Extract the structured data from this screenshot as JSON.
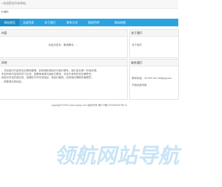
{
  "topbar": {
    "welcome": "• 欢迎您访问本网站。"
  },
  "logo": {
    "text": "Logo"
  },
  "nav": {
    "items": [
      {
        "label": "网站首页",
        "active": true
      },
      {
        "label": "全部列表"
      },
      {
        "label": "关于我们"
      },
      {
        "label": "联系方式"
      },
      {
        "label": "版权声明"
      },
      {
        "label": "网站地图"
      }
    ]
  },
  "main_panel": {
    "title": "内容",
    "body": "欢迎浏览本，敬请期待……"
  },
  "about_panel": {
    "title": "关于我们",
    "body": "关于我们"
  },
  "notice_panel": {
    "title": "声明",
    "body_lines": [
      "，本站部分内容来自互联网整理，如有侵权请及时与我们联系，我们会在第一时间处理。",
      "本站所有内容仅供学习交流，如需商用请与版权方联系，本站不承担任何法律责任。",
      "网站对内容的真实性、准确性不作任何保证，请自行甄别，如有疑问请联系管理员。",
      "，转载请注明出处。"
    ]
  },
  "contact_panel": {
    "title": "联系我们",
    "phone": "联系电话：23 009 341  1M@qq.com",
    "email": "齐依信息举报"
  },
  "footer": {
    "copyright": "copyright©2020 www.qnxqr.com 版权所有  蜀ICP备2020059487号-11"
  },
  "watermark": {
    "text": "领航网站导航"
  }
}
